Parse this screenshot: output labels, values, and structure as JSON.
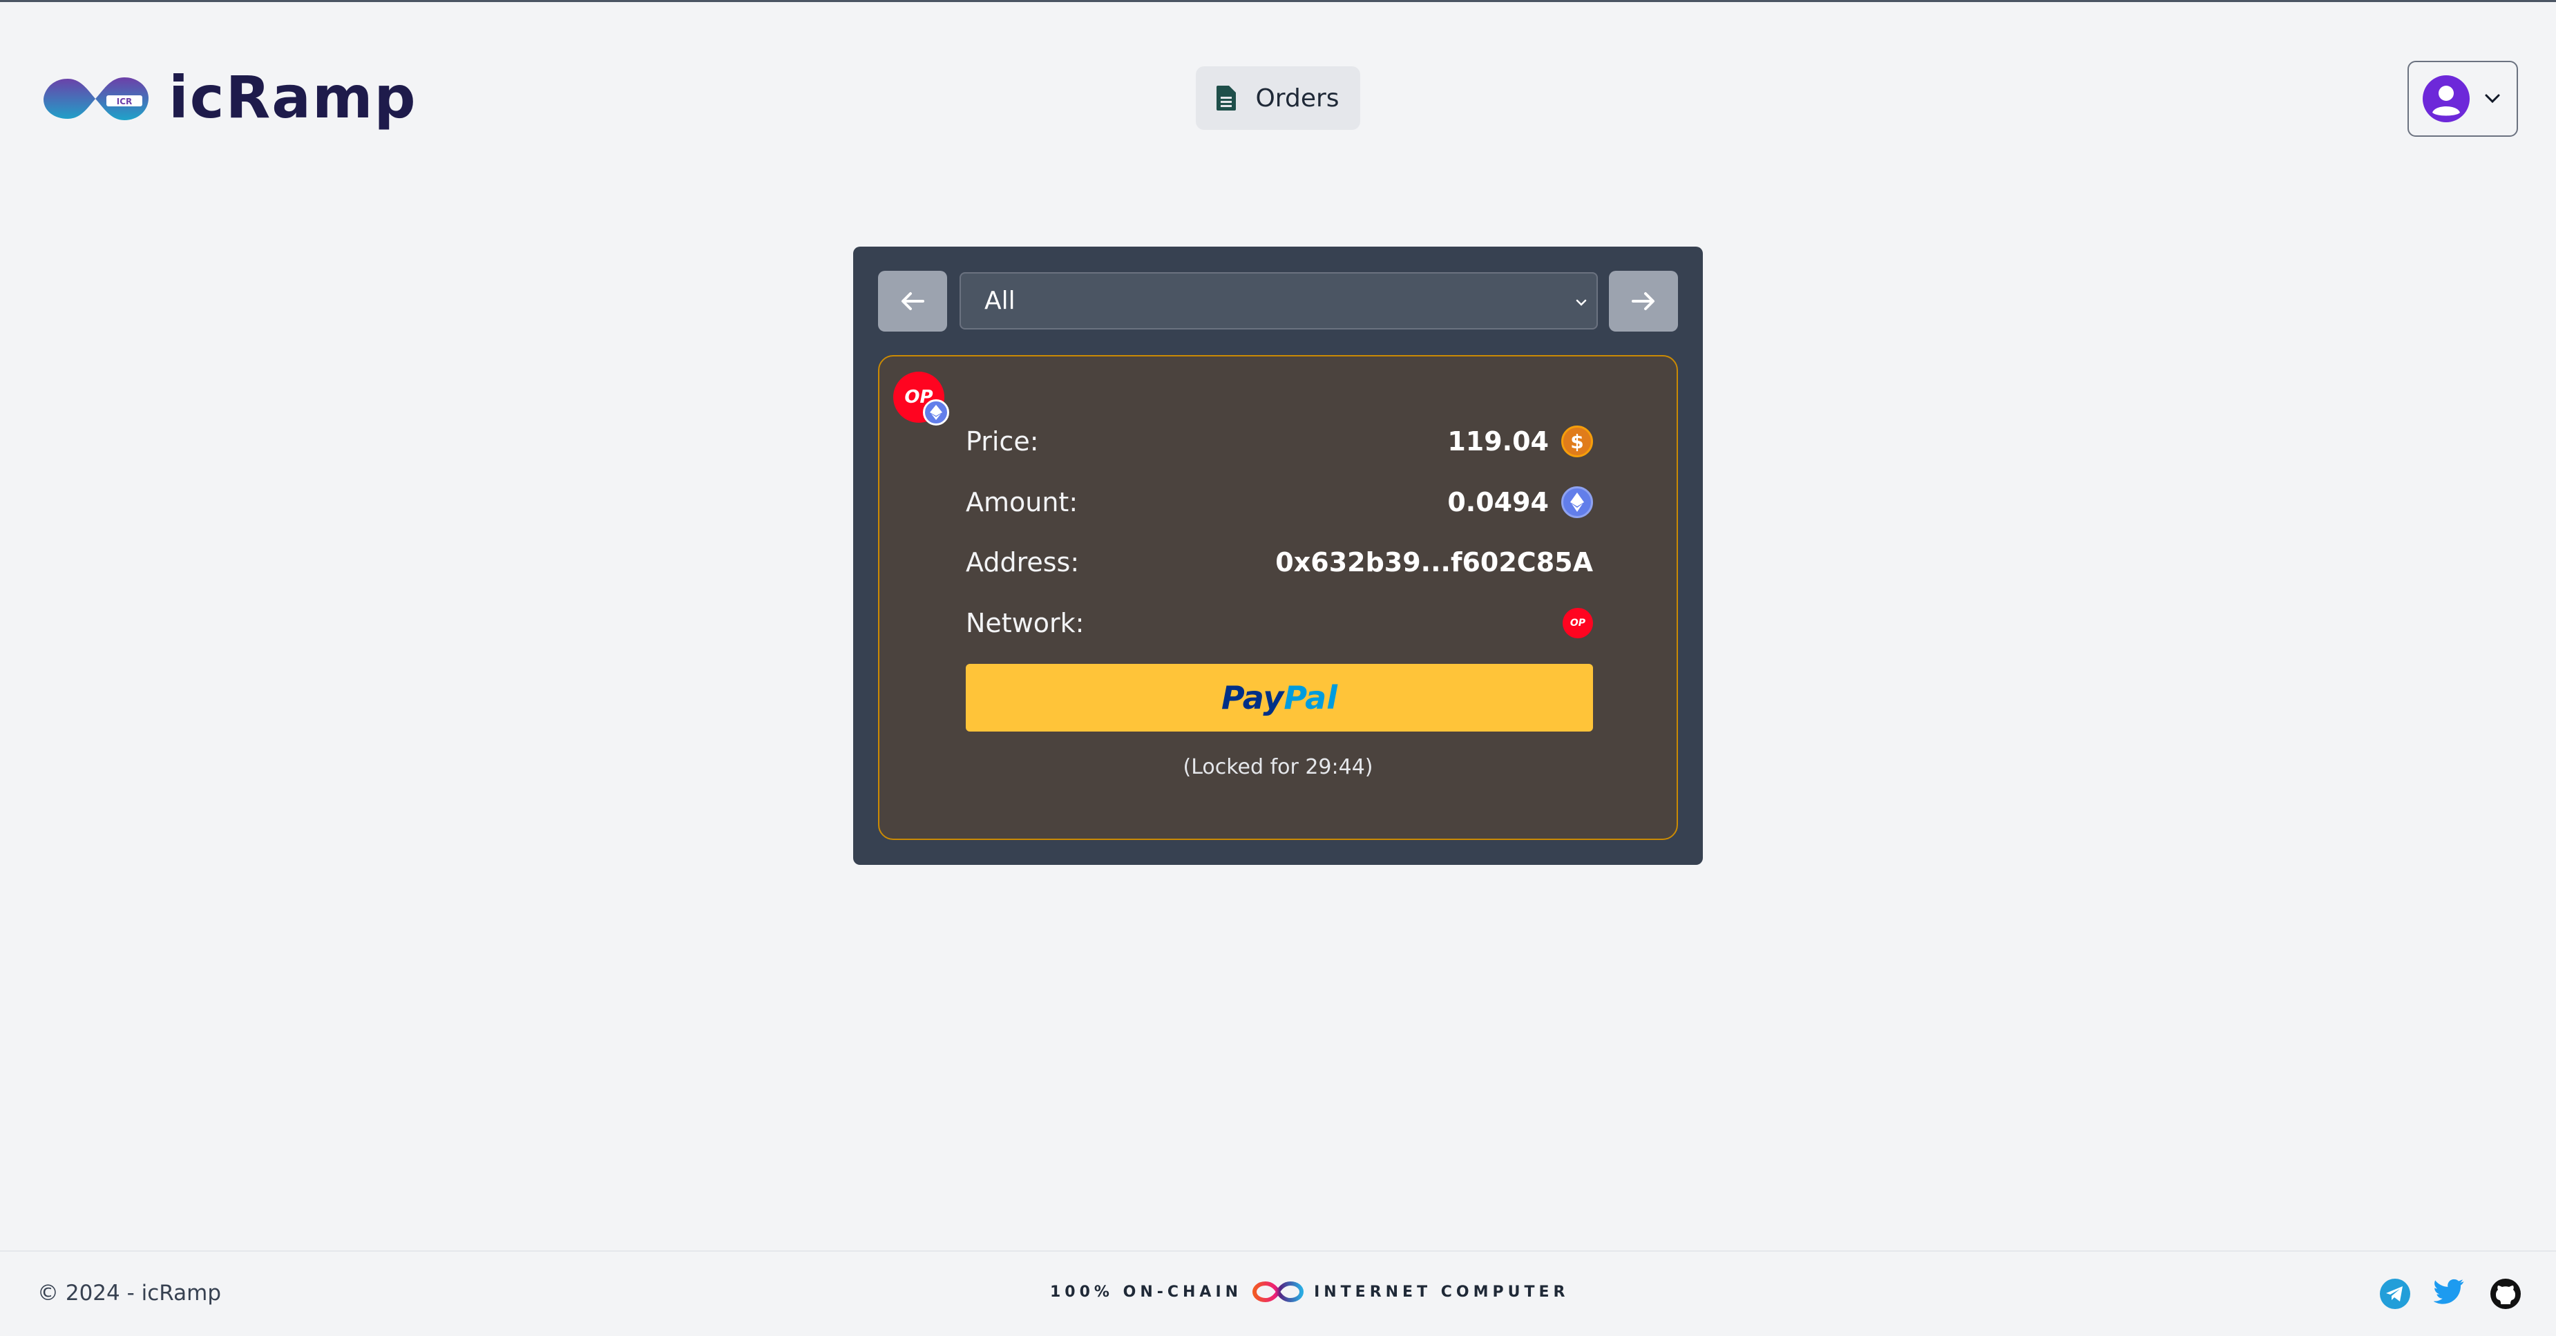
{
  "header": {
    "brand": "icRamp",
    "orders_label": "Orders"
  },
  "filter": {
    "selected": "All"
  },
  "offer": {
    "price_label": "Price:",
    "price_value": "119.04",
    "amount_label": "Amount:",
    "amount_value": "0.0494",
    "address_label": "Address:",
    "address_value": "0x632b39...f602C85A",
    "network_label": "Network:",
    "network_badge": "OP",
    "paypal_pay": "Pay",
    "paypal_pal": "Pal",
    "locked_text": "(Locked for 29:44)"
  },
  "footer": {
    "copyright": "© 2024 - icRamp",
    "onchain_left": "100% ON-CHAIN",
    "onchain_right": "INTERNET COMPUTER"
  },
  "colors": {
    "background": "#f3f4f6",
    "panel": "#374151",
    "offer_card": "#4b433e",
    "offer_border": "#ca8a04",
    "paypal_yellow": "#ffc439",
    "op_red": "#ff0420",
    "eth_blue": "#627eea",
    "brand_text": "#1e1b4b"
  },
  "icons": [
    "icramp-logo-icon",
    "document-icon",
    "user-avatar-icon",
    "chevron-down-icon",
    "arrow-left-icon",
    "arrow-right-icon",
    "optimism-icon",
    "ethereum-icon",
    "usd-coin-icon",
    "infinity-icon",
    "telegram-icon",
    "twitter-icon",
    "github-icon"
  ]
}
